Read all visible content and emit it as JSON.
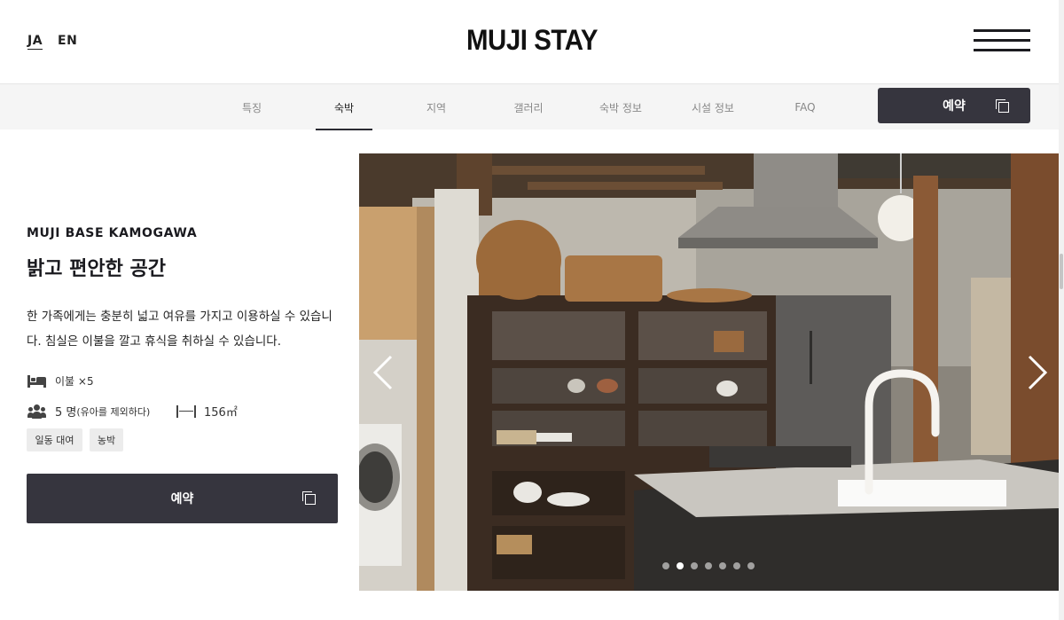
{
  "header": {
    "lang_ja": "JA",
    "lang_en": "EN",
    "logo": "MUJI STAY"
  },
  "nav": {
    "items": [
      {
        "label": "특징"
      },
      {
        "label": "숙박"
      },
      {
        "label": "지역"
      },
      {
        "label": "갤러리"
      },
      {
        "label": "숙박 정보"
      },
      {
        "label": "시설 정보"
      },
      {
        "label": "FAQ"
      }
    ],
    "active": "숙박",
    "reserve_label": "예약"
  },
  "room": {
    "subtitle": "MUJI BASE KAMOGAWA",
    "title": "밝고 편안한 공간",
    "description": "한 가족에게는 충분히 넓고 여유를 가지고 이용하실 수 있습니다. 침실은 이불을 깔고 휴식을 취하실 수 있습니다.",
    "beds": "이불 ×5",
    "guests_count": "5 명",
    "guests_note": "(유아를 제외하다)",
    "area": "156㎡",
    "tags": [
      "일동 대여",
      "농박"
    ],
    "reserve_label": "예약"
  },
  "carousel": {
    "slide_count": 7,
    "active_index": 1
  },
  "colors": {
    "button_dark": "#36353e",
    "nav_bg": "#f5f5f5"
  }
}
